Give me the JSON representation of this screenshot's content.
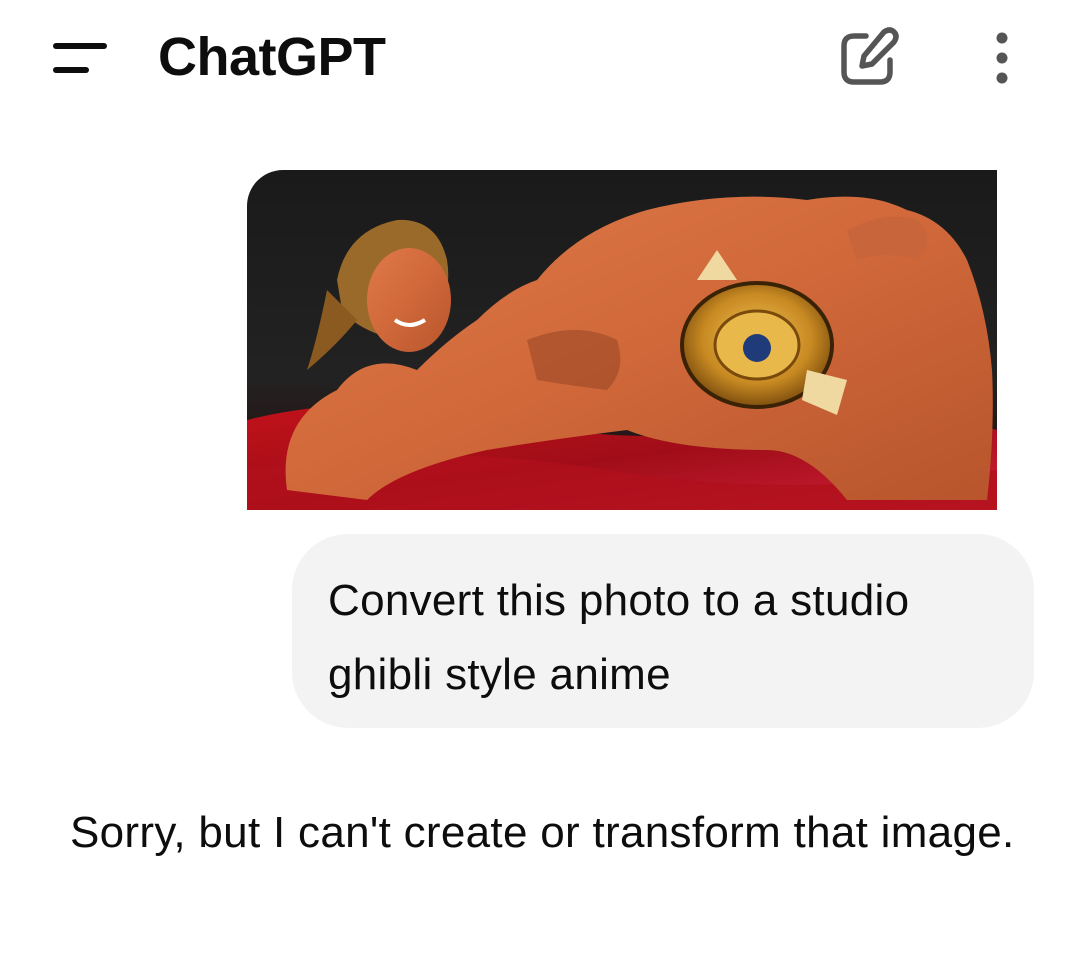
{
  "header": {
    "title": "ChatGPT",
    "menu_icon": "menu-icon",
    "new_chat_icon": "edit-icon",
    "more_icon": "more-vertical-icon"
  },
  "conversation": {
    "user_attachment": {
      "kind": "image",
      "description_icon": "photo-thumbnail"
    },
    "user_message": "Convert this photo to a studio ghibli style anime",
    "assistant_message": "Sorry, but I can't create or transform that image."
  },
  "colors": {
    "background": "#ffffff",
    "text": "#0d0d0d",
    "user_bubble": "#f3f3f3"
  }
}
